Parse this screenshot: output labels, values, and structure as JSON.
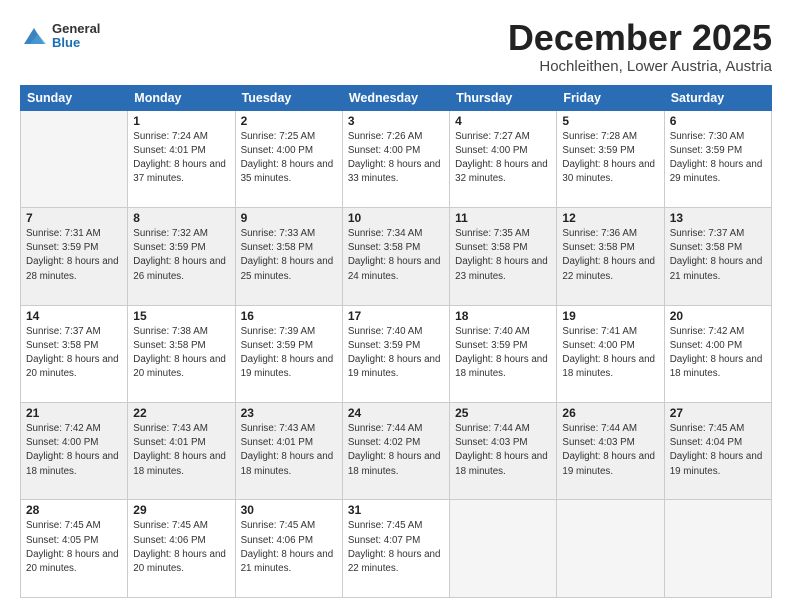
{
  "header": {
    "logo_line1": "General",
    "logo_line2": "Blue",
    "title": "December 2025",
    "subtitle": "Hochleithen, Lower Austria, Austria"
  },
  "weekdays": [
    "Sunday",
    "Monday",
    "Tuesday",
    "Wednesday",
    "Thursday",
    "Friday",
    "Saturday"
  ],
  "weeks": [
    [
      {
        "day": "",
        "sunrise": "",
        "sunset": "",
        "daylight": "",
        "empty": true
      },
      {
        "day": "1",
        "sunrise": "Sunrise: 7:24 AM",
        "sunset": "Sunset: 4:01 PM",
        "daylight": "Daylight: 8 hours and 37 minutes."
      },
      {
        "day": "2",
        "sunrise": "Sunrise: 7:25 AM",
        "sunset": "Sunset: 4:00 PM",
        "daylight": "Daylight: 8 hours and 35 minutes."
      },
      {
        "day": "3",
        "sunrise": "Sunrise: 7:26 AM",
        "sunset": "Sunset: 4:00 PM",
        "daylight": "Daylight: 8 hours and 33 minutes."
      },
      {
        "day": "4",
        "sunrise": "Sunrise: 7:27 AM",
        "sunset": "Sunset: 4:00 PM",
        "daylight": "Daylight: 8 hours and 32 minutes."
      },
      {
        "day": "5",
        "sunrise": "Sunrise: 7:28 AM",
        "sunset": "Sunset: 3:59 PM",
        "daylight": "Daylight: 8 hours and 30 minutes."
      },
      {
        "day": "6",
        "sunrise": "Sunrise: 7:30 AM",
        "sunset": "Sunset: 3:59 PM",
        "daylight": "Daylight: 8 hours and 29 minutes."
      }
    ],
    [
      {
        "day": "7",
        "sunrise": "Sunrise: 7:31 AM",
        "sunset": "Sunset: 3:59 PM",
        "daylight": "Daylight: 8 hours and 28 minutes."
      },
      {
        "day": "8",
        "sunrise": "Sunrise: 7:32 AM",
        "sunset": "Sunset: 3:59 PM",
        "daylight": "Daylight: 8 hours and 26 minutes."
      },
      {
        "day": "9",
        "sunrise": "Sunrise: 7:33 AM",
        "sunset": "Sunset: 3:58 PM",
        "daylight": "Daylight: 8 hours and 25 minutes."
      },
      {
        "day": "10",
        "sunrise": "Sunrise: 7:34 AM",
        "sunset": "Sunset: 3:58 PM",
        "daylight": "Daylight: 8 hours and 24 minutes."
      },
      {
        "day": "11",
        "sunrise": "Sunrise: 7:35 AM",
        "sunset": "Sunset: 3:58 PM",
        "daylight": "Daylight: 8 hours and 23 minutes."
      },
      {
        "day": "12",
        "sunrise": "Sunrise: 7:36 AM",
        "sunset": "Sunset: 3:58 PM",
        "daylight": "Daylight: 8 hours and 22 minutes."
      },
      {
        "day": "13",
        "sunrise": "Sunrise: 7:37 AM",
        "sunset": "Sunset: 3:58 PM",
        "daylight": "Daylight: 8 hours and 21 minutes."
      }
    ],
    [
      {
        "day": "14",
        "sunrise": "Sunrise: 7:37 AM",
        "sunset": "Sunset: 3:58 PM",
        "daylight": "Daylight: 8 hours and 20 minutes."
      },
      {
        "day": "15",
        "sunrise": "Sunrise: 7:38 AM",
        "sunset": "Sunset: 3:58 PM",
        "daylight": "Daylight: 8 hours and 20 minutes."
      },
      {
        "day": "16",
        "sunrise": "Sunrise: 7:39 AM",
        "sunset": "Sunset: 3:59 PM",
        "daylight": "Daylight: 8 hours and 19 minutes."
      },
      {
        "day": "17",
        "sunrise": "Sunrise: 7:40 AM",
        "sunset": "Sunset: 3:59 PM",
        "daylight": "Daylight: 8 hours and 19 minutes."
      },
      {
        "day": "18",
        "sunrise": "Sunrise: 7:40 AM",
        "sunset": "Sunset: 3:59 PM",
        "daylight": "Daylight: 8 hours and 18 minutes."
      },
      {
        "day": "19",
        "sunrise": "Sunrise: 7:41 AM",
        "sunset": "Sunset: 4:00 PM",
        "daylight": "Daylight: 8 hours and 18 minutes."
      },
      {
        "day": "20",
        "sunrise": "Sunrise: 7:42 AM",
        "sunset": "Sunset: 4:00 PM",
        "daylight": "Daylight: 8 hours and 18 minutes."
      }
    ],
    [
      {
        "day": "21",
        "sunrise": "Sunrise: 7:42 AM",
        "sunset": "Sunset: 4:00 PM",
        "daylight": "Daylight: 8 hours and 18 minutes."
      },
      {
        "day": "22",
        "sunrise": "Sunrise: 7:43 AM",
        "sunset": "Sunset: 4:01 PM",
        "daylight": "Daylight: 8 hours and 18 minutes."
      },
      {
        "day": "23",
        "sunrise": "Sunrise: 7:43 AM",
        "sunset": "Sunset: 4:01 PM",
        "daylight": "Daylight: 8 hours and 18 minutes."
      },
      {
        "day": "24",
        "sunrise": "Sunrise: 7:44 AM",
        "sunset": "Sunset: 4:02 PM",
        "daylight": "Daylight: 8 hours and 18 minutes."
      },
      {
        "day": "25",
        "sunrise": "Sunrise: 7:44 AM",
        "sunset": "Sunset: 4:03 PM",
        "daylight": "Daylight: 8 hours and 18 minutes."
      },
      {
        "day": "26",
        "sunrise": "Sunrise: 7:44 AM",
        "sunset": "Sunset: 4:03 PM",
        "daylight": "Daylight: 8 hours and 19 minutes."
      },
      {
        "day": "27",
        "sunrise": "Sunrise: 7:45 AM",
        "sunset": "Sunset: 4:04 PM",
        "daylight": "Daylight: 8 hours and 19 minutes."
      }
    ],
    [
      {
        "day": "28",
        "sunrise": "Sunrise: 7:45 AM",
        "sunset": "Sunset: 4:05 PM",
        "daylight": "Daylight: 8 hours and 20 minutes."
      },
      {
        "day": "29",
        "sunrise": "Sunrise: 7:45 AM",
        "sunset": "Sunset: 4:06 PM",
        "daylight": "Daylight: 8 hours and 20 minutes."
      },
      {
        "day": "30",
        "sunrise": "Sunrise: 7:45 AM",
        "sunset": "Sunset: 4:06 PM",
        "daylight": "Daylight: 8 hours and 21 minutes."
      },
      {
        "day": "31",
        "sunrise": "Sunrise: 7:45 AM",
        "sunset": "Sunset: 4:07 PM",
        "daylight": "Daylight: 8 hours and 22 minutes."
      },
      {
        "day": "",
        "sunrise": "",
        "sunset": "",
        "daylight": "",
        "empty": true
      },
      {
        "day": "",
        "sunrise": "",
        "sunset": "",
        "daylight": "",
        "empty": true
      },
      {
        "day": "",
        "sunrise": "",
        "sunset": "",
        "daylight": "",
        "empty": true
      }
    ]
  ]
}
